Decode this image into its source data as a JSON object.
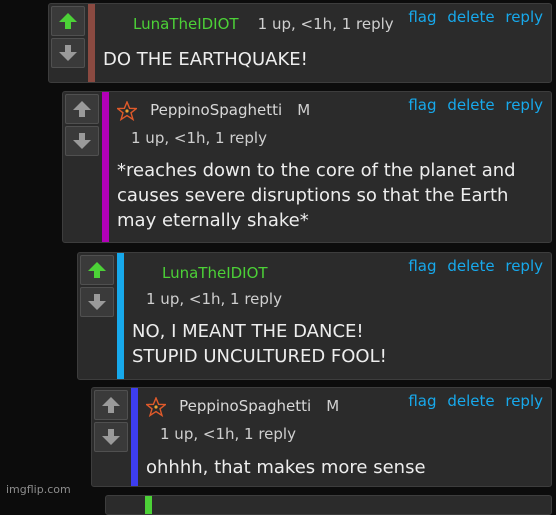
{
  "actions": {
    "flag": "flag",
    "delete": "delete",
    "reply": "reply"
  },
  "colors": {
    "upvote": "#4cd137",
    "downvote": "#9a9a9a",
    "link": "#17a9ec"
  },
  "comments": [
    {
      "user": "LunaTheIDIOT",
      "meta": "1 up, <1h, 1 reply",
      "mod": "",
      "lines": [
        "DO THE EARTHQUAKE!"
      ],
      "stripe": "#8b4a41",
      "upvoted": true
    },
    {
      "user": "PeppinoSpaghetti",
      "meta": "1 up, <1h, 1 reply",
      "mod": "M",
      "lines": [
        "*reaches down to the core of the planet and",
        "causes severe disruptions so that the Earth",
        "may eternally shake*"
      ],
      "stripe": "#b300b8",
      "upvoted": false
    },
    {
      "user": "LunaTheIDIOT",
      "meta": "1 up, <1h, 1 reply",
      "mod": "",
      "lines": [
        "NO, I MEANT THE DANCE!",
        "STUPID UNCULTURED FOOL!"
      ],
      "stripe": "#17a9ec",
      "upvoted": true
    },
    {
      "user": "PeppinoSpaghetti",
      "meta": "1 up, <1h, 1 reply",
      "mod": "M",
      "lines": [
        "ohhhh, that makes more sense"
      ],
      "stripe": "#3d3df0",
      "upvoted": false
    }
  ],
  "watermark": "imgflip.com"
}
